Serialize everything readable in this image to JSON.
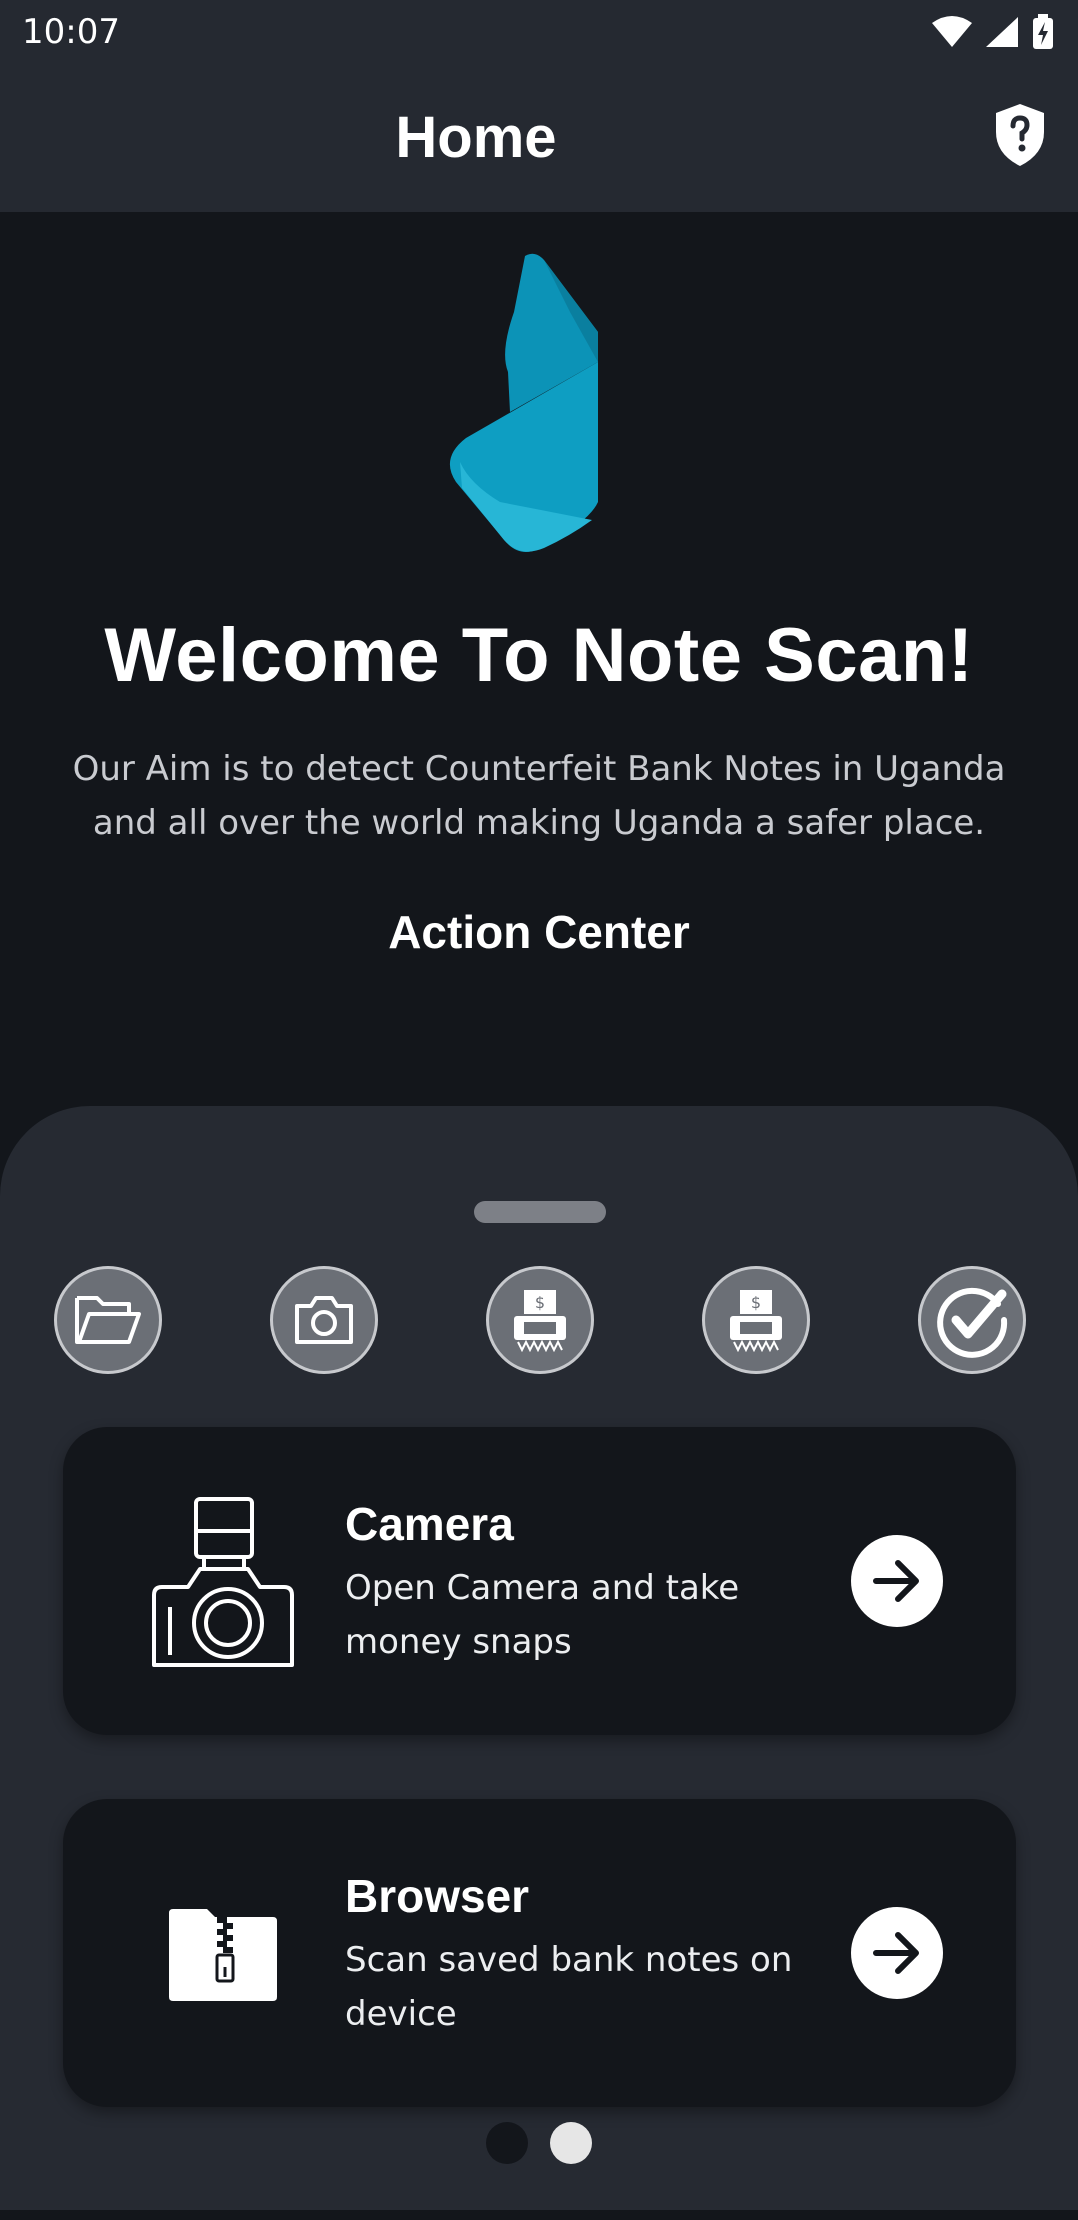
{
  "status_bar": {
    "time": "10:07",
    "icons": [
      "wifi-icon",
      "signal-icon",
      "battery-charging-icon"
    ]
  },
  "app_bar": {
    "title": "Home",
    "help_icon": "shield-question-icon"
  },
  "hero": {
    "title": "Welcome To Note Scan!",
    "description": "Our Aim is to detect Counterfeit Bank Notes in Uganda and all over the world making Uganda a safer place.",
    "section_title": "Action Center"
  },
  "quick_actions": [
    {
      "icon": "folder-open-icon"
    },
    {
      "icon": "camera-icon"
    },
    {
      "icon": "money-scan-icon"
    },
    {
      "icon": "money-scan-icon"
    },
    {
      "icon": "check-circle-icon"
    }
  ],
  "cards": [
    {
      "title": "Camera",
      "description": "Open Camera and take money snaps",
      "icon": "camera-flash-icon",
      "action_icon": "arrow-right-icon"
    },
    {
      "title": "Browser",
      "description": "Scan saved bank notes on device",
      "icon": "zip-folder-icon",
      "action_icon": "arrow-right-icon"
    }
  ],
  "pager": {
    "pages": 2,
    "active_index": 1
  },
  "colors": {
    "background": "#13161b",
    "surface": "#252931",
    "sheet": "#262a32",
    "accent": "#0e9ec2"
  }
}
